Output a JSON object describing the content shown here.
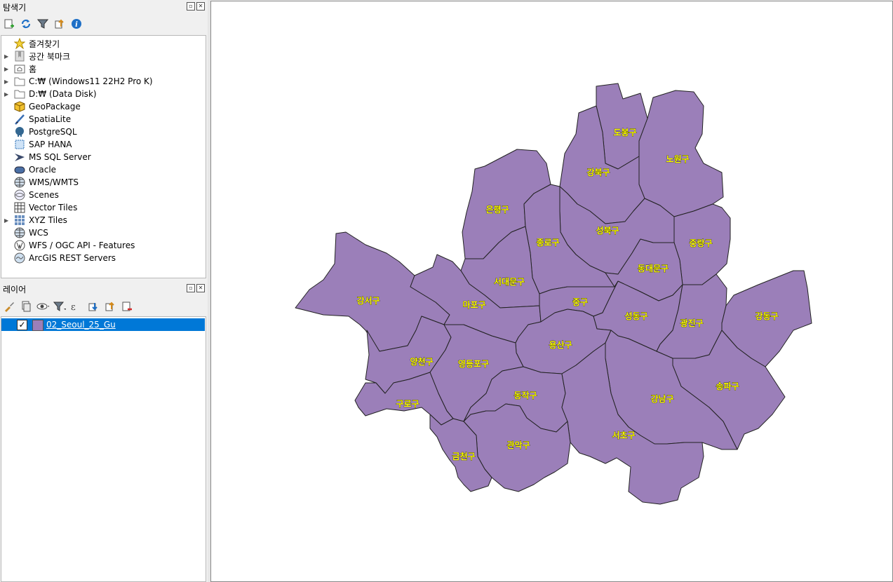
{
  "browser": {
    "title": "탐색기",
    "items": [
      {
        "label": "즐겨찾기",
        "icon": "star-icon",
        "expand": false
      },
      {
        "label": "공간 북마크",
        "icon": "bookmark-icon",
        "expand": true
      },
      {
        "label": "홈",
        "icon": "home-folder-icon",
        "expand": true
      },
      {
        "label": "C:₩ (Windows11 22H2 Pro K)",
        "icon": "folder-icon",
        "expand": true
      },
      {
        "label": "D:₩ (Data Disk)",
        "icon": "folder-icon",
        "expand": true
      },
      {
        "label": "GeoPackage",
        "icon": "geopackage-icon",
        "expand": false
      },
      {
        "label": "SpatiaLite",
        "icon": "spatialite-icon",
        "expand": false
      },
      {
        "label": "PostgreSQL",
        "icon": "postgresql-icon",
        "expand": false
      },
      {
        "label": "SAP HANA",
        "icon": "sap-hana-icon",
        "expand": false
      },
      {
        "label": "MS SQL Server",
        "icon": "mssql-icon",
        "expand": false
      },
      {
        "label": "Oracle",
        "icon": "oracle-icon",
        "expand": false
      },
      {
        "label": "WMS/WMTS",
        "icon": "globe-icon",
        "expand": false
      },
      {
        "label": "Scenes",
        "icon": "scenes-icon",
        "expand": false
      },
      {
        "label": "Vector Tiles",
        "icon": "vector-tiles-icon",
        "expand": false
      },
      {
        "label": "XYZ Tiles",
        "icon": "xyz-tiles-icon",
        "expand": true
      },
      {
        "label": "WCS",
        "icon": "globe-icon",
        "expand": false
      },
      {
        "label": "WFS / OGC API - Features",
        "icon": "wfs-icon",
        "expand": false
      },
      {
        "label": "ArcGIS REST Servers",
        "icon": "arcgis-icon",
        "expand": false
      }
    ]
  },
  "layers": {
    "title": "레이어",
    "items": [
      {
        "label": "02_Seoul_25_Gu",
        "checked": true,
        "color": "#9b7fb9"
      }
    ]
  },
  "map": {
    "fill": "#9b7fb9",
    "label_color": "#ffff00",
    "districts": [
      "도봉구",
      "노원구",
      "강북구",
      "은평구",
      "성북구",
      "종로구",
      "중랑구",
      "동대문구",
      "서대문구",
      "강서구",
      "마포구",
      "중구",
      "성동구",
      "광진구",
      "강동구",
      "용산구",
      "양천구",
      "영등포구",
      "송파구",
      "구로구",
      "동작구",
      "강남구",
      "서초구",
      "관악구",
      "금천구"
    ]
  }
}
